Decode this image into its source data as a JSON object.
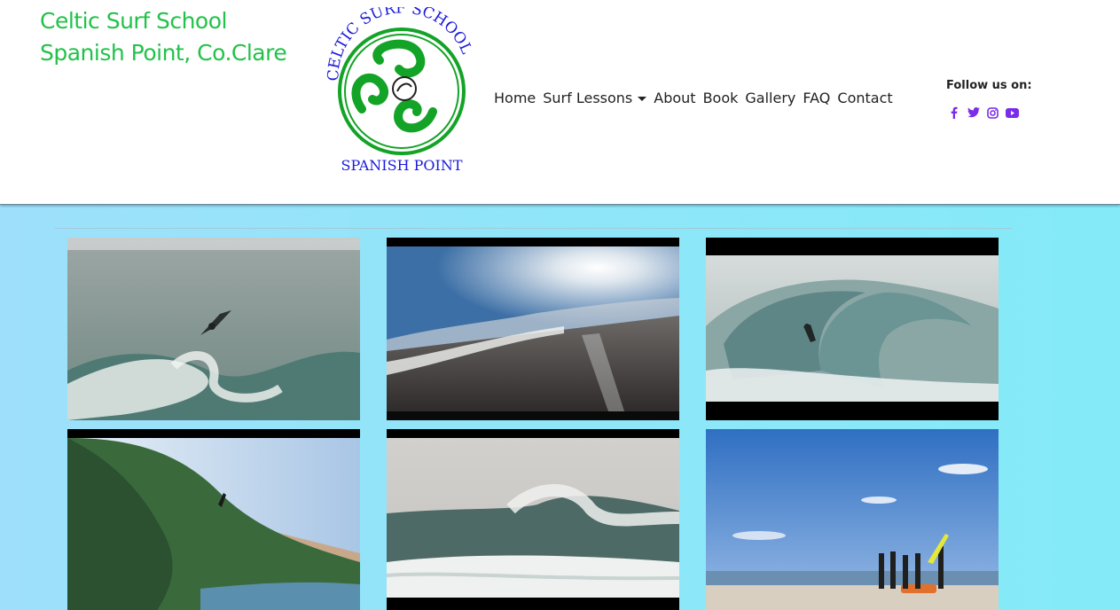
{
  "brand": {
    "line1": "Celtic Surf School",
    "line2": "Spanish Point, Co.Clare",
    "color": "#22c24a"
  },
  "logo": {
    "top_text": "CELTIC SURF SCHOOL",
    "bottom_text": "SPANISH POINT",
    "ring_color": "#13a326",
    "text_color": "#1a1adb"
  },
  "nav": {
    "items": [
      {
        "label": "Home"
      },
      {
        "label": "Surf Lessons",
        "dropdown": true
      },
      {
        "label": "About"
      },
      {
        "label": "Book"
      },
      {
        "label": "Gallery"
      },
      {
        "label": "FAQ"
      },
      {
        "label": "Contact"
      }
    ]
  },
  "social": {
    "label": "Follow us on:",
    "icons": [
      "facebook-icon",
      "twitter-icon",
      "instagram-icon",
      "youtube-icon"
    ],
    "color": "#7a2ce8"
  },
  "gallery": {
    "tiles": [
      {
        "name": "surfer-aerial-photo"
      },
      {
        "name": "sunny-beach-photo"
      },
      {
        "name": "barrel-wave-photo"
      },
      {
        "name": "green-wave-photo"
      },
      {
        "name": "breaking-wave-photo"
      },
      {
        "name": "surf-group-beach-photo"
      }
    ]
  }
}
